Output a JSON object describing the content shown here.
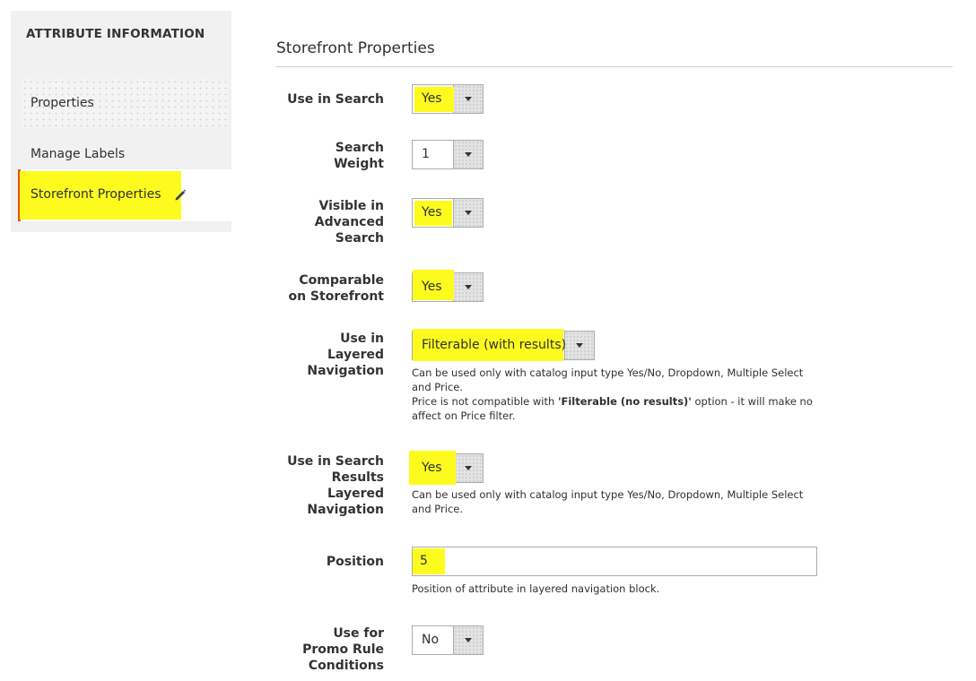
{
  "sidebar": {
    "title": "ATTRIBUTE INFORMATION",
    "items": [
      {
        "label": "Properties"
      },
      {
        "label": "Manage Labels"
      },
      {
        "label": "Storefront Properties",
        "active": true
      }
    ]
  },
  "section": {
    "title": "Storefront Properties"
  },
  "fields": {
    "use_in_search": {
      "label": "Use in Search",
      "value": "Yes"
    },
    "search_weight": {
      "label_line1": "Search",
      "label_line2": "Weight",
      "value": "1"
    },
    "visible_advanced": {
      "label_line1": "Visible in",
      "label_line2": "Advanced",
      "label_line3": "Search",
      "value": "Yes"
    },
    "comparable": {
      "label_line1": "Comparable",
      "label_line2": "on Storefront",
      "value": "Yes"
    },
    "layered_nav": {
      "label_line1": "Use in",
      "label_line2": "Layered",
      "label_line3": "Navigation",
      "value": "Filterable (with results)",
      "note_line1": "Can be used only with catalog input type Yes/No, Dropdown, Multiple Select and Price.",
      "note_line2_pre": "Price is not compatible with ",
      "note_line2_bold": "'Filterable (no results)'",
      "note_line2_post": " option - it will make no affect on Price filter."
    },
    "search_results_layered": {
      "label_line1": "Use in Search",
      "label_line2": "Results",
      "label_line3": "Layered",
      "label_line4": "Navigation",
      "value": "Yes",
      "note": "Can be used only with catalog input type Yes/No, Dropdown, Multiple Select and Price."
    },
    "position": {
      "label": "Position",
      "value": "5",
      "note": "Position of attribute in layered navigation block."
    },
    "promo_rule": {
      "label_line1": "Use for",
      "label_line2": "Promo Rule",
      "label_line3": "Conditions",
      "value": "No"
    }
  },
  "colors": {
    "highlight": "#fdfb1e",
    "active_border": "#eb5202"
  }
}
